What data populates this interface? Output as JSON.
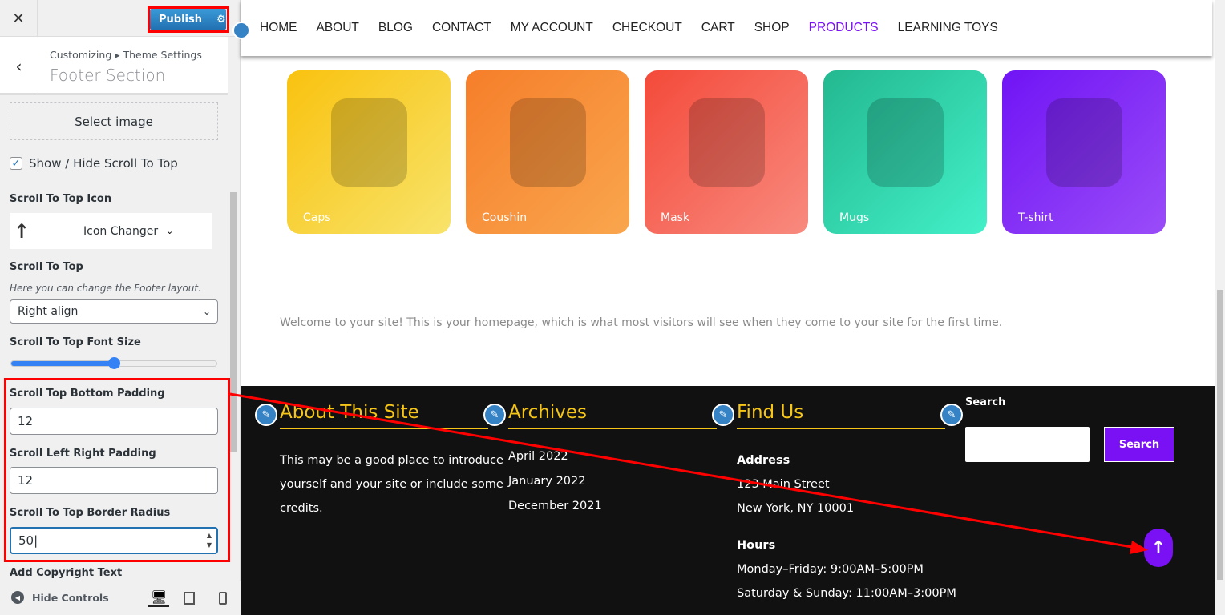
{
  "sidebar": {
    "publish_label": "Publish",
    "breadcrumb": "Customizing ▸ Theme Settings",
    "section_title": "Footer Section",
    "select_image": "Select image",
    "show_hide_label": "Show / Hide Scroll To Top",
    "show_hide_checked": true,
    "icon_label": "Scroll To Top Icon",
    "icon_changer": "Icon Changer",
    "scroll_to_top_label": "Scroll To Top",
    "scroll_to_top_desc": "Here you can change the Footer layout.",
    "align_value": "Right align",
    "font_size_label": "Scroll To Top Font Size",
    "font_size_fraction": 0.5,
    "bottom_padding_label": "Scroll Top Bottom Padding",
    "bottom_padding_value": "12",
    "lr_padding_label": "Scroll Left Right Padding",
    "lr_padding_value": "12",
    "radius_label": "Scroll To Top Border Radius",
    "radius_value": "50",
    "copyright_label": "Add Copyright Text",
    "hide_controls": "Hide Controls"
  },
  "nav": [
    "HOME",
    "ABOUT",
    "BLOG",
    "CONTACT",
    "MY ACCOUNT",
    "CHECKOUT",
    "CART",
    "SHOP",
    "PRODUCTS",
    "LEARNING TOYS"
  ],
  "nav_active": "PRODUCTS",
  "products": [
    {
      "label": "Caps",
      "colors": [
        "#f9c20f",
        "#f8e36a"
      ]
    },
    {
      "label": "Coushin",
      "colors": [
        "#f67e2a",
        "#f9a64e"
      ]
    },
    {
      "label": "Mask",
      "colors": [
        "#f44a3a",
        "#f88a7e"
      ]
    },
    {
      "label": "Mugs",
      "colors": [
        "#23b890",
        "#43f0c8"
      ]
    },
    {
      "label": "T-shirt",
      "colors": [
        "#7014f5",
        "#9a4cf8"
      ]
    }
  ],
  "welcome": "Welcome to your site! This is your homepage, which is what most visitors will see when they come to your site for the first time.",
  "footer": {
    "about_title": "About This Site",
    "about_lines": [
      "This may be a good place to introduce",
      "yourself and your site or include some",
      "credits."
    ],
    "archives_title": "Archives",
    "archives": [
      "April 2022",
      "January 2022",
      "December 2021"
    ],
    "find_title": "Find Us",
    "address_label": "Address",
    "address_lines": [
      "123 Main Street",
      "New York, NY 10001"
    ],
    "hours_label": "Hours",
    "hours_lines": [
      "Monday–Friday: 9:00AM–5:00PM",
      "Saturday & Sunday: 11:00AM–3:00PM"
    ],
    "search_label": "Search",
    "search_button": "Search"
  },
  "colors": {
    "accent": "#7a11f5",
    "footer_heading": "#f5c518",
    "annotation": "#ff0000"
  }
}
